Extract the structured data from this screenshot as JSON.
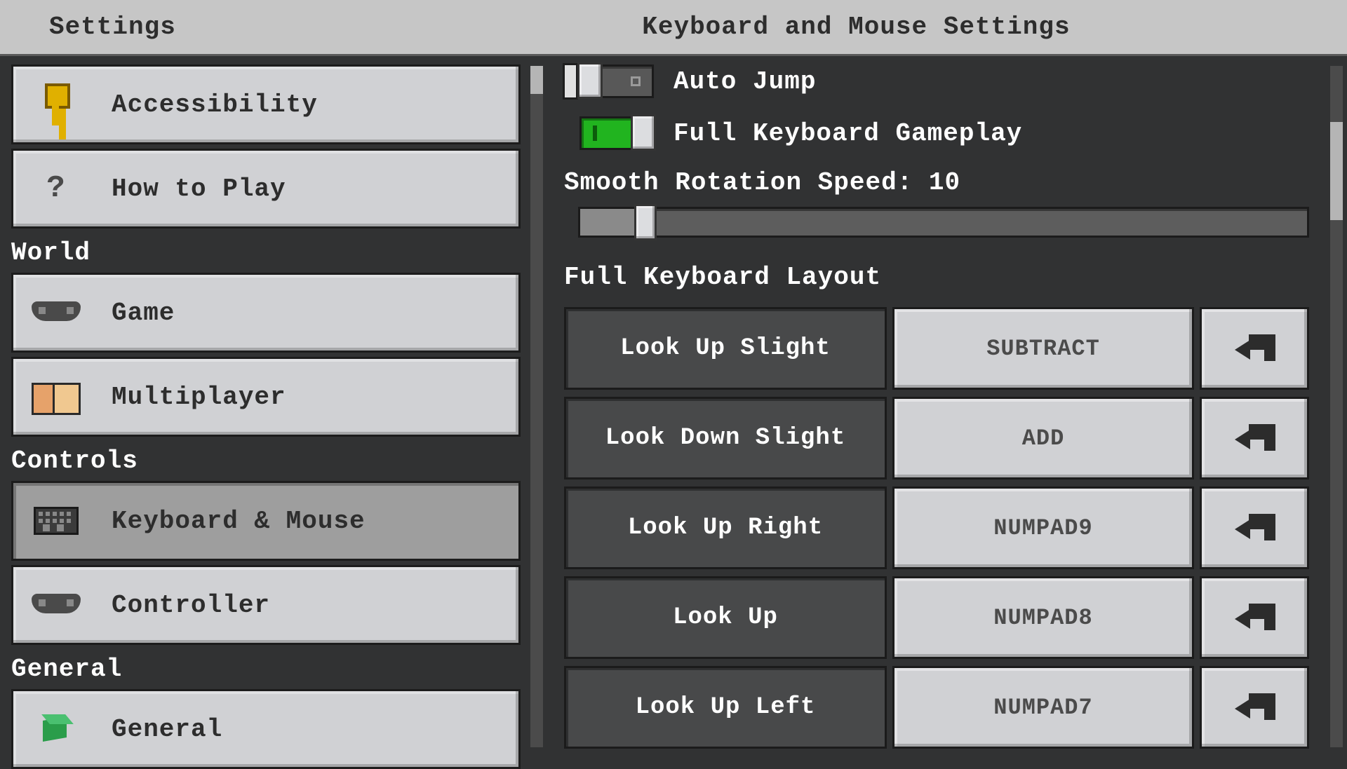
{
  "header": {
    "left": "Settings",
    "right": "Keyboard and Mouse Settings"
  },
  "sidebar": {
    "items": [
      {
        "label": "Accessibility",
        "icon": "key"
      },
      {
        "label": "How to Play",
        "icon": "question"
      }
    ],
    "sectionWorld": "World",
    "worldItems": [
      {
        "label": "Game",
        "icon": "controller"
      },
      {
        "label": "Multiplayer",
        "icon": "faces"
      }
    ],
    "sectionControls": "Controls",
    "controlsItems": [
      {
        "label": "Keyboard & Mouse",
        "icon": "keyboard",
        "selected": true
      },
      {
        "label": "Controller",
        "icon": "controller"
      }
    ],
    "sectionGeneral": "General",
    "generalItems": [
      {
        "label": "General",
        "icon": "cube"
      }
    ]
  },
  "main": {
    "autoJump": {
      "label": "Auto Jump",
      "value": false
    },
    "fullKeyboard": {
      "label": "Full Keyboard Gameplay",
      "value": true
    },
    "rotationLabel": "Smooth Rotation Speed: 10",
    "rotationValue": 10,
    "layoutHeader": "Full Keyboard Layout",
    "bindings": [
      {
        "action": "Look Up Slight",
        "key": "SUBTRACT"
      },
      {
        "action": "Look Down Slight",
        "key": "ADD"
      },
      {
        "action": "Look Up Right",
        "key": "NUMPAD9"
      },
      {
        "action": "Look Up",
        "key": "NUMPAD8"
      },
      {
        "action": "Look Up Left",
        "key": "NUMPAD7"
      }
    ]
  }
}
